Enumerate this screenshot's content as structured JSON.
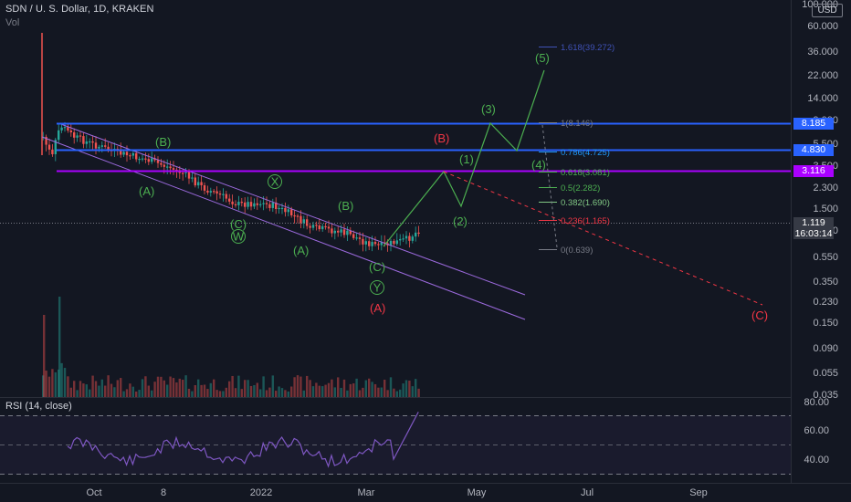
{
  "header": {
    "title": "SDN / U. S. Dollar, 1D, KRAKEN",
    "volume_label": "Vol",
    "currency_button": "USD"
  },
  "rsi": {
    "label": "RSI (14, close)"
  },
  "price_scale": {
    "ticks": [
      "100.000",
      "60.000",
      "36.000",
      "22.000",
      "14.000",
      "9.000",
      "5.500",
      "3.500",
      "2.300",
      "1.500",
      "0.900",
      "0.550",
      "0.350",
      "0.230",
      "0.150",
      "0.090",
      "0.055",
      "0.035"
    ],
    "rsi_ticks": [
      "80.00",
      "60.00",
      "40.00"
    ]
  },
  "time_axis": {
    "labels": [
      "Oct",
      "8",
      "2022",
      "Mar",
      "May",
      "Jul",
      "Sep"
    ]
  },
  "price_tags": [
    {
      "value": "8.185",
      "color": "#2962ff"
    },
    {
      "value": "4.830",
      "color": "#2962ff"
    },
    {
      "value": "3.116",
      "color": "#aa00ff"
    }
  ],
  "current_price": {
    "value": "1.119",
    "countdown": "16:03:14",
    "color": "#363a45"
  },
  "fib_levels": [
    {
      "label": "1.618(39.272)",
      "color": "#3f51b5"
    },
    {
      "label": "1(8.146)",
      "color": "#787b86"
    },
    {
      "label": "0.786(4.725)",
      "color": "#2196f3"
    },
    {
      "label": "0.618(3.081)",
      "color": "#4caf50"
    },
    {
      "label": "0.5(2.282)",
      "color": "#4caf50"
    },
    {
      "label": "0.382(1.690)",
      "color": "#81c784"
    },
    {
      "label": "0.236(1.165)",
      "color": "#f23645"
    },
    {
      "label": "0(0.639)",
      "color": "#787b86"
    }
  ],
  "wave_labels": [
    {
      "text": "(B)",
      "color": "#4caf50"
    },
    {
      "text": "(A)",
      "color": "#4caf50"
    },
    {
      "text": "X",
      "color": "#4caf50",
      "circled": true
    },
    {
      "text": "(C)",
      "color": "#4caf50"
    },
    {
      "text": "W",
      "color": "#4caf50",
      "circled": true
    },
    {
      "text": "(B)",
      "color": "#4caf50"
    },
    {
      "text": "(A)",
      "color": "#4caf50"
    },
    {
      "text": "(C)",
      "color": "#4caf50"
    },
    {
      "text": "Y",
      "color": "#4caf50",
      "circled": true
    },
    {
      "text": "(A)",
      "color": "#f23645"
    },
    {
      "text": "(B)",
      "color": "#f23645"
    },
    {
      "text": "(C)",
      "color": "#f23645"
    },
    {
      "text": "(1)",
      "color": "#4caf50"
    },
    {
      "text": "(2)",
      "color": "#4caf50"
    },
    {
      "text": "(3)",
      "color": "#4caf50"
    },
    {
      "text": "(4)",
      "color": "#4caf50"
    },
    {
      "text": "(5)",
      "color": "#4caf50"
    }
  ],
  "colors": {
    "background": "#131722",
    "candle_up": "#26a69a",
    "candle_down": "#ef5350",
    "channel": "#9c6ade",
    "projection": "#4caf50",
    "rsi_line": "#7e57c2"
  }
}
